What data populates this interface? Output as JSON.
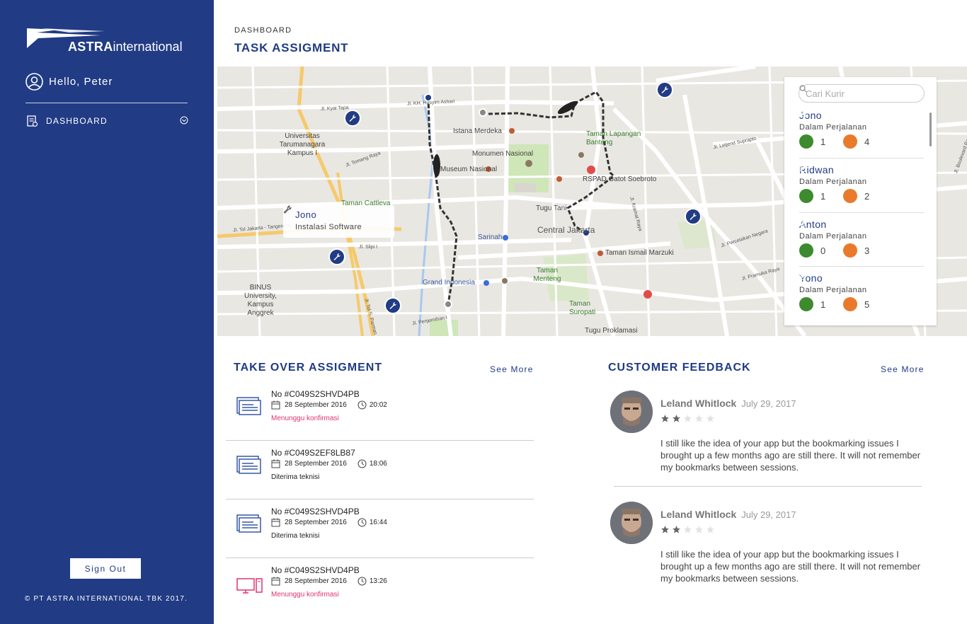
{
  "brand": {
    "name_bold": "ASTRA",
    "name_light": "international",
    "copyright": "© PT ASTRA INTERNATIONAL TBK 2017."
  },
  "user": {
    "greeting": "Hello, Peter"
  },
  "sidebar": {
    "items": [
      {
        "label": "DASHBOARD"
      }
    ],
    "signout": "Sign Out"
  },
  "header": {
    "breadcrumb": "DASHBOARD",
    "title": "TASK ASSIGMENT"
  },
  "map": {
    "tooltip": {
      "name": "Jono",
      "task": "Instalasi Software"
    },
    "labels": {
      "istana": "Istana Merdeka",
      "monas_1": "Monumen Nasional",
      "monas_2": "Museum Nasional",
      "lapangan": "Taman Lapangan Banteng",
      "rspad": "RSPAD Gatot Soebroto",
      "tugu_tani": "Tugu Tani",
      "central": "Central Jakarta",
      "tim": "Taman Ismail Marzuki",
      "sarinah": "Sarinah",
      "grand_indonesia": "Grand Indonesia",
      "menteng": "Taman Menteng",
      "suropati": "Taman Suropati",
      "proklamasi": "Tugu Proklamasi",
      "untar": "Universitas Tarumanagara Kampus I",
      "binus": "BINUS University, Kampus Anggrek",
      "cattleya": "Taman Cattleya"
    },
    "streets": {
      "kyai_tapa": "Jl. Kyai Tapa",
      "kh_hasyim": "Jl. KH. Hasyim Ashari",
      "tomang": "Jl. Tomang Raya",
      "tol": "Jl. Tol Jakarta - Tangerang",
      "slipi": "Jl. Slipi I",
      "tol_s": "Jl. Tol S. Parman",
      "penjernihan": "Jl. Penjernihan I",
      "letjend": "Jl. Letjend Suprapto",
      "kramat": "Jl. Kramat Raya",
      "percetakan": "Jl. Percetakan Negara",
      "pramuka": "Jl. Pramuka Raya",
      "boulevard": "Jl. Boulevard Raya"
    }
  },
  "courier_panel": {
    "search_placeholder": "Cari Kurir",
    "couriers": [
      {
        "name": "Jono",
        "status": "Dalam Perjalanan",
        "tasks": "1",
        "orders": "4"
      },
      {
        "name": "Ridwan",
        "status": "Dalam Perjalanan",
        "tasks": "1",
        "orders": "2"
      },
      {
        "name": "Anton",
        "status": "Dalam Perjalanan",
        "tasks": "0",
        "orders": "3"
      },
      {
        "name": "Yono",
        "status": "Dalam Perjalanan",
        "tasks": "1",
        "orders": "5"
      }
    ]
  },
  "takeover": {
    "title": "TAKE OVER ASSIGMENT",
    "see_more": "See More",
    "items": [
      {
        "no": "No #C049S2SHVD4PB",
        "date": "28 September 2016",
        "time": "20:02",
        "status": "Menunggu konfirmasi",
        "status_color": "#e0336a",
        "icon": "document-icon"
      },
      {
        "no": "No #C049S2EF8LB87",
        "date": "28 September 2016",
        "time": "18:06",
        "status": "Diterima teknisi",
        "status_color": "#222222",
        "icon": "document-icon"
      },
      {
        "no": "No #C049S2SHVD4PB",
        "date": "28 September 2016",
        "time": "16:44",
        "status": "Diterima teknisi",
        "status_color": "#222222",
        "icon": "document-icon"
      },
      {
        "no": "No #C049S2SHVD4PB",
        "date": "28 September 2016",
        "time": "13:26",
        "status": "Menunggu konfirmasi",
        "status_color": "#e0336a",
        "icon": "computer-icon"
      }
    ]
  },
  "feedback": {
    "title": "CUSTOMER FEEDBACK",
    "see_more": "See More",
    "items": [
      {
        "name": "Leland Whitlock",
        "date": "July 29, 2017",
        "rating": 2,
        "max_rating": 5,
        "text": "I still like the idea of your app but the bookmarking issues I brought up a few months ago are still there. It will not remember my bookmarks between sessions."
      },
      {
        "name": "Leland Whitlock",
        "date": "July 29, 2017",
        "rating": 2,
        "max_rating": 5,
        "text": "I still like the idea of your app but the bookmarking issues I brought up a few months ago are still there. It will not remember my bookmarks between sessions."
      }
    ]
  },
  "colors": {
    "brand": "#213b84",
    "pending": "#e0336a",
    "task_green": "#3d8a2f",
    "order_orange": "#ea7a2b",
    "route": "#333333"
  }
}
